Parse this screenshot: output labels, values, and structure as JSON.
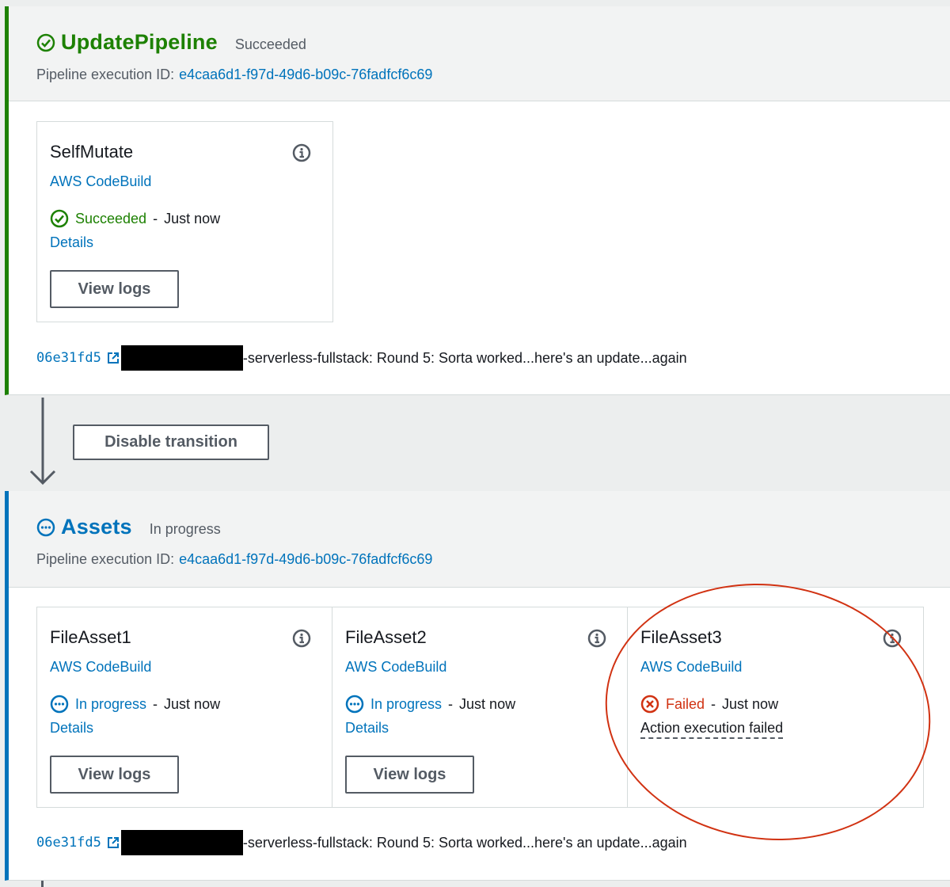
{
  "stages": [
    {
      "name": "UpdatePipeline",
      "state": "Succeeded",
      "exec_label": "Pipeline execution ID:",
      "exec_id": "e4caa6d1-f97d-49d6-b09c-76fadfcf6c69",
      "actions": [
        {
          "name": "SelfMutate",
          "provider": "AWS CodeBuild",
          "status": "Succeeded",
          "separator": "-",
          "time": "Just now",
          "details": "Details",
          "button": "View logs"
        }
      ],
      "commit": {
        "hash": "06e31fd5",
        "message": "-serverless-fullstack: Round 5: Sorta worked...here's an update...again"
      }
    },
    {
      "name": "Assets",
      "state": "In progress",
      "exec_label": "Pipeline execution ID:",
      "exec_id": "e4caa6d1-f97d-49d6-b09c-76fadfcf6c69",
      "actions": [
        {
          "name": "FileAsset1",
          "provider": "AWS CodeBuild",
          "status": "In progress",
          "separator": "-",
          "time": "Just now",
          "details": "Details",
          "button": "View logs"
        },
        {
          "name": "FileAsset2",
          "provider": "AWS CodeBuild",
          "status": "In progress",
          "separator": "-",
          "time": "Just now",
          "details": "Details",
          "button": "View logs"
        },
        {
          "name": "FileAsset3",
          "provider": "AWS CodeBuild",
          "status": "Failed",
          "separator": "-",
          "time": "Just now",
          "failure": "Action execution failed"
        }
      ],
      "commit": {
        "hash": "06e31fd5",
        "message": "-serverless-fullstack: Round 5: Sorta worked...here's an update...again"
      }
    }
  ],
  "transition_button": "Disable transition",
  "colors": {
    "success": "#1d8102",
    "progress": "#0073bb",
    "failed": "#d13212",
    "annotation_circle": "#d13212"
  },
  "icons": [
    "success-check-icon",
    "in-progress-icon",
    "failed-x-icon",
    "info-icon",
    "external-link-icon",
    "down-arrow-icon"
  ]
}
